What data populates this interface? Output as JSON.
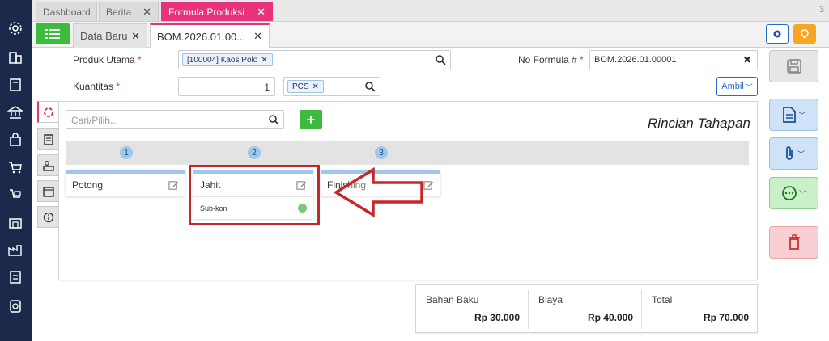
{
  "tabs": [
    {
      "label": "Dashboard"
    },
    {
      "label": "Berita"
    },
    {
      "label": "Formula Produksi"
    }
  ],
  "tab_count": "3",
  "subtabs": [
    {
      "label": "Data Baru"
    },
    {
      "label": "BOM.2026.01.00..."
    }
  ],
  "form": {
    "produk_label": "Produk Utama",
    "produk_value": "[100004] Kaos Polo",
    "kuantitas_label": "Kuantitas",
    "kuantitas_value": "1",
    "unit_value": "PCS",
    "no_formula_label": "No Formula #",
    "no_formula_value": "BOM.2026.01.00001",
    "ambil_label": "Ambil",
    "required_mark": "*"
  },
  "panel": {
    "search_placeholder": "Cari/Pilih...",
    "add_label": "+",
    "title": "Rincian Tahapan",
    "stages": [
      {
        "number": "1",
        "name": "Potong"
      },
      {
        "number": "2",
        "name": "Jahit",
        "sub": "Sub-kon"
      },
      {
        "number": "3",
        "name": "Finishing"
      }
    ]
  },
  "totals": {
    "bahan_baku_label": "Bahan Baku",
    "bahan_baku_value": "Rp 30.000",
    "biaya_label": "Biaya",
    "biaya_value": "Rp 40.000",
    "total_label": "Total",
    "total_value": "Rp 70.000"
  },
  "colors": {
    "accent": "#e8337a",
    "nav": "#1b2a4a",
    "green": "#3dbb3d",
    "blue_action": "#cfe3f8",
    "green_action": "#c9f0c9",
    "red_action": "#f8d0d3",
    "annotation": "#c62828"
  }
}
